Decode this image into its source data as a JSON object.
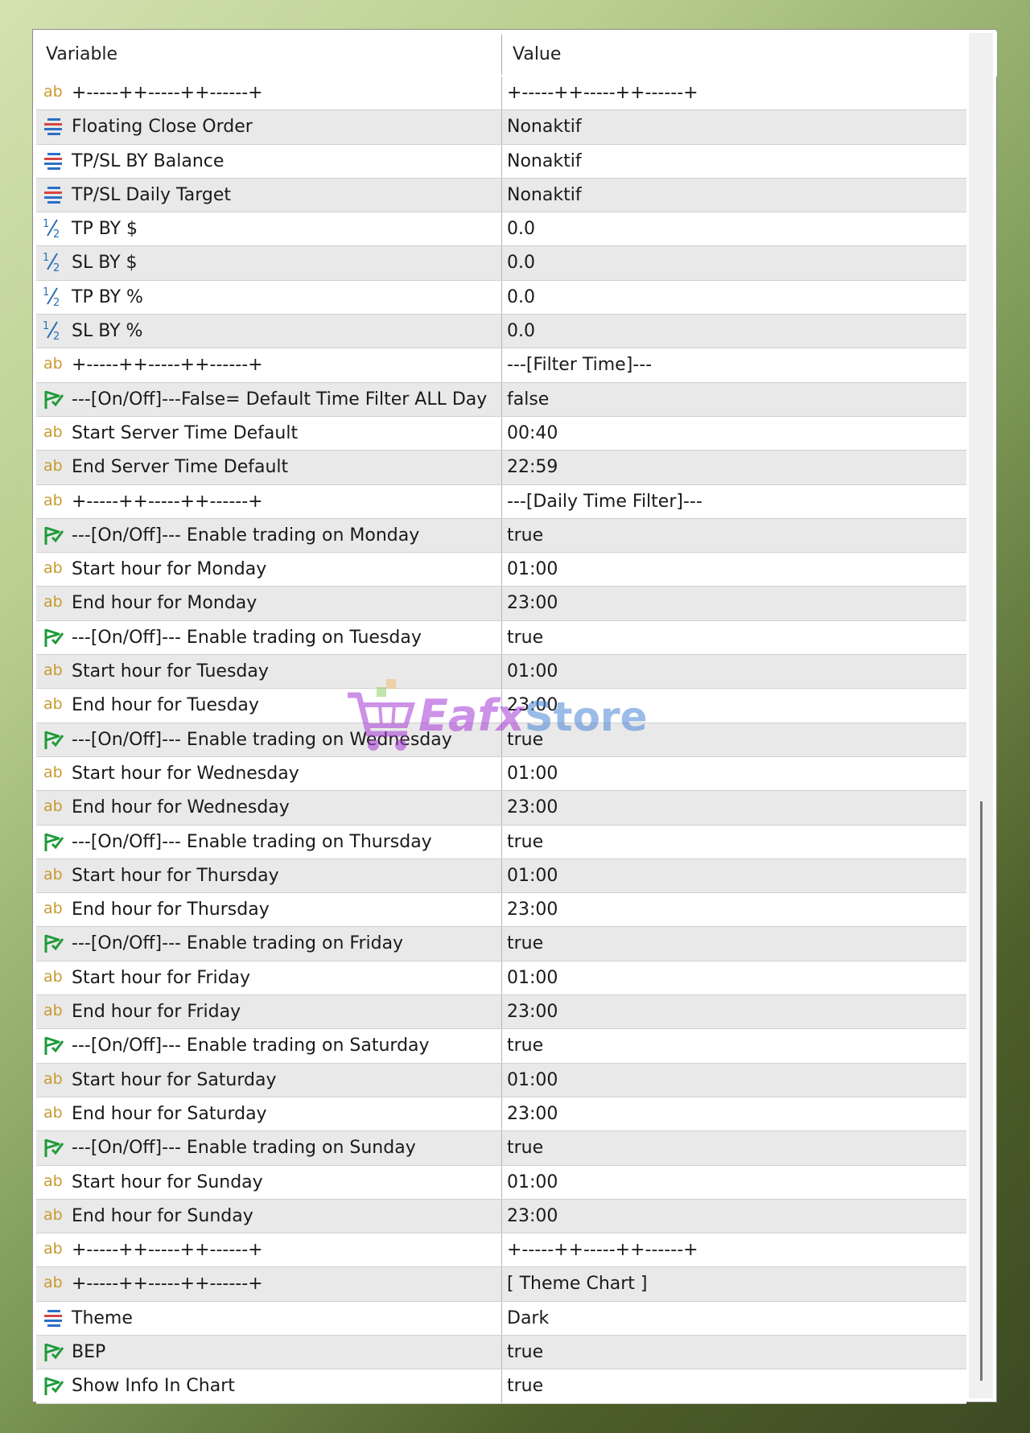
{
  "header": {
    "variable_label": "Variable",
    "value_label": "Value"
  },
  "watermark": {
    "brand": "Eafx",
    "suffix": "Store"
  },
  "rows": [
    {
      "icon": "ab",
      "variable": "+-----++-----++------+",
      "value": "+-----++-----++------+"
    },
    {
      "icon": "enum",
      "variable": "Floating Close Order",
      "value": "Nonaktif"
    },
    {
      "icon": "enum",
      "variable": "TP/SL BY Balance",
      "value": "Nonaktif"
    },
    {
      "icon": "enum",
      "variable": "TP/SL Daily Target",
      "value": "Nonaktif"
    },
    {
      "icon": "half",
      "variable": "TP BY $",
      "value": "0.0"
    },
    {
      "icon": "half",
      "variable": "SL BY $",
      "value": "0.0"
    },
    {
      "icon": "half",
      "variable": "TP BY %",
      "value": "0.0"
    },
    {
      "icon": "half",
      "variable": "SL BY %",
      "value": "0.0"
    },
    {
      "icon": "ab",
      "variable": "+-----++-----++------+",
      "value": "---[Filter Time]---"
    },
    {
      "icon": "bool",
      "variable": "---[On/Off]---False= Default Time Filter ALL Day",
      "value": "false"
    },
    {
      "icon": "ab",
      "variable": "Start Server Time Default",
      "value": "00:40"
    },
    {
      "icon": "ab",
      "variable": "End Server Time Default",
      "value": "22:59"
    },
    {
      "icon": "ab",
      "variable": "+-----++-----++------+",
      "value": "---[Daily Time Filter]---"
    },
    {
      "icon": "bool",
      "variable": "---[On/Off]--- Enable trading on Monday",
      "value": "true"
    },
    {
      "icon": "ab",
      "variable": "Start hour for Monday",
      "value": "01:00"
    },
    {
      "icon": "ab",
      "variable": "End hour for Monday",
      "value": "23:00"
    },
    {
      "icon": "bool",
      "variable": "---[On/Off]--- Enable trading on Tuesday",
      "value": "true"
    },
    {
      "icon": "ab",
      "variable": "Start hour for Tuesday",
      "value": "01:00"
    },
    {
      "icon": "ab",
      "variable": "End hour for Tuesday",
      "value": "23:00"
    },
    {
      "icon": "bool",
      "variable": "---[On/Off]--- Enable trading on Wednesday",
      "value": "true"
    },
    {
      "icon": "ab",
      "variable": "Start hour for Wednesday",
      "value": "01:00"
    },
    {
      "icon": "ab",
      "variable": "End hour for Wednesday",
      "value": "23:00"
    },
    {
      "icon": "bool",
      "variable": "---[On/Off]--- Enable trading on Thursday",
      "value": "true"
    },
    {
      "icon": "ab",
      "variable": "Start hour for Thursday",
      "value": "01:00"
    },
    {
      "icon": "ab",
      "variable": "End hour for Thursday",
      "value": "23:00"
    },
    {
      "icon": "bool",
      "variable": "---[On/Off]--- Enable trading on Friday",
      "value": "true"
    },
    {
      "icon": "ab",
      "variable": "Start hour for Friday",
      "value": "01:00"
    },
    {
      "icon": "ab",
      "variable": "End hour for Friday",
      "value": "23:00"
    },
    {
      "icon": "bool",
      "variable": "---[On/Off]--- Enable trading on Saturday",
      "value": "true"
    },
    {
      "icon": "ab",
      "variable": "Start hour for Saturday",
      "value": "01:00"
    },
    {
      "icon": "ab",
      "variable": "End hour for Saturday",
      "value": "23:00"
    },
    {
      "icon": "bool",
      "variable": "---[On/Off]--- Enable trading on Sunday",
      "value": "true"
    },
    {
      "icon": "ab",
      "variable": "Start hour for Sunday",
      "value": "01:00"
    },
    {
      "icon": "ab",
      "variable": "End hour for Sunday",
      "value": "23:00"
    },
    {
      "icon": "ab",
      "variable": "+-----++-----++------+",
      "value": "+-----++-----++------+"
    },
    {
      "icon": "ab",
      "variable": "+-----++-----++------+",
      "value": "[ Theme Chart ]"
    },
    {
      "icon": "enum",
      "variable": "Theme",
      "value": "Dark"
    },
    {
      "icon": "bool",
      "variable": "BEP",
      "value": "true"
    },
    {
      "icon": "bool",
      "variable": "Show Info In Chart",
      "value": "true"
    }
  ]
}
